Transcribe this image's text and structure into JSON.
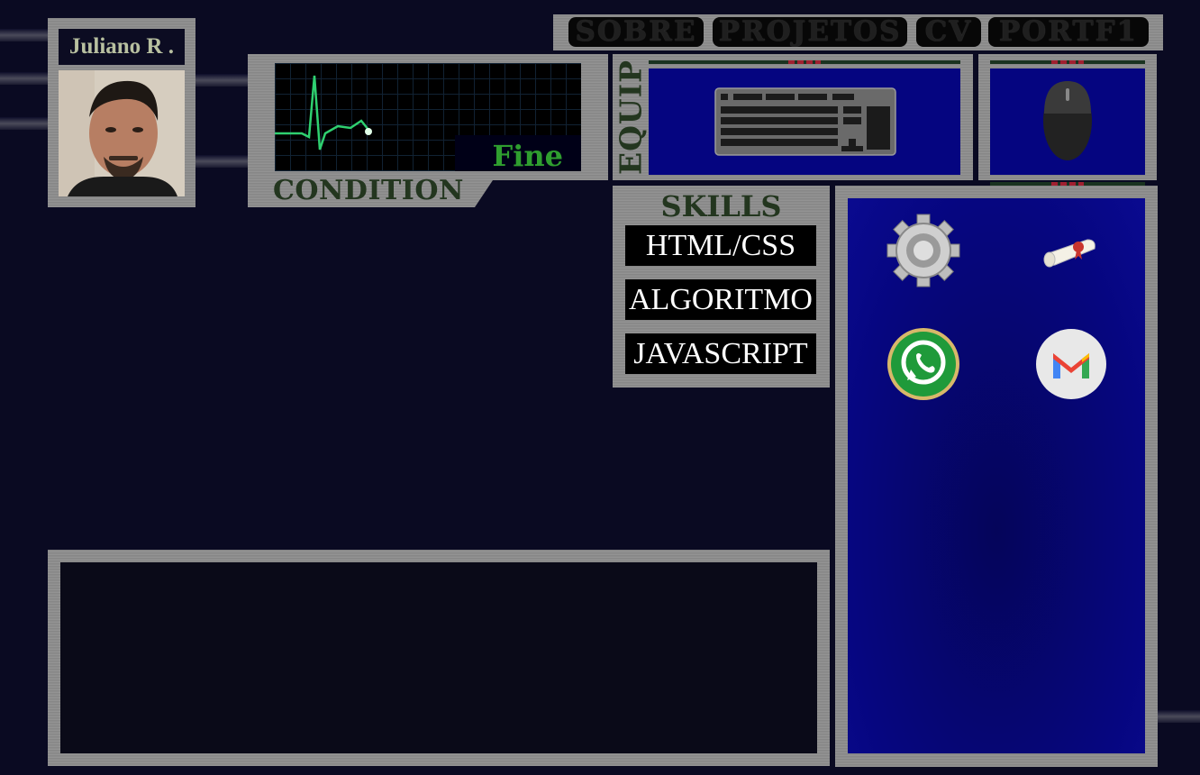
{
  "nav": {
    "items": [
      {
        "label": "SOBRE"
      },
      {
        "label": "PROJETOS"
      },
      {
        "label": "CV"
      },
      {
        "label": "PORTF1"
      }
    ]
  },
  "profile": {
    "name": "Juliano R ."
  },
  "condition": {
    "status": "Fine",
    "label": "CONDITION",
    "colors": {
      "trace": "#2fd070",
      "status": "#2f9e2f"
    }
  },
  "equip": {
    "label": "EQUIP",
    "items": [
      "keyboard-icon",
      "mouse-icon"
    ]
  },
  "skills": {
    "title": "SKILLS",
    "items": [
      {
        "label": "HTML/CSS"
      },
      {
        "label": "ALGORITMO"
      },
      {
        "label": "JAVASCRIPT"
      }
    ]
  },
  "links": {
    "icons": [
      "gear-icon",
      "diploma-icon",
      "whatsapp-icon",
      "gmail-icon"
    ]
  }
}
